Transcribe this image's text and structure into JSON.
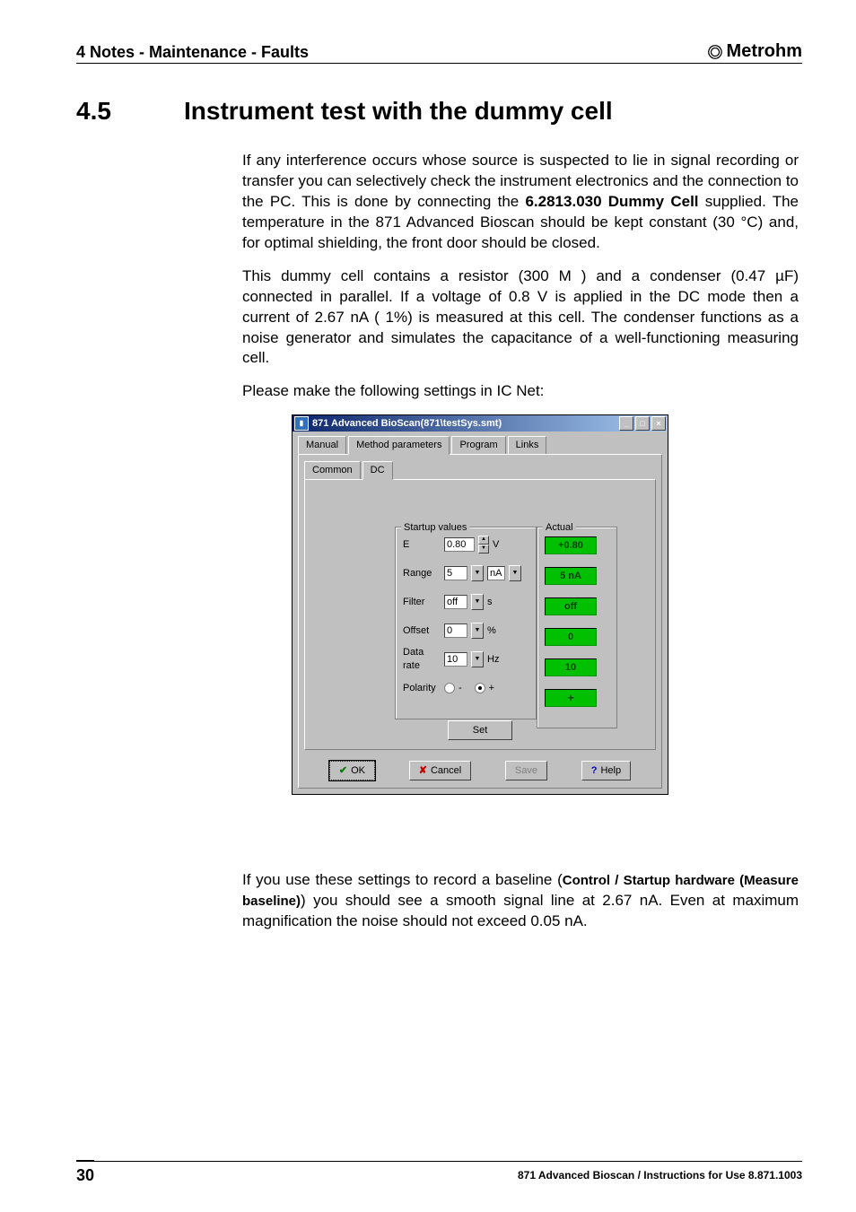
{
  "header": {
    "left": "4 Notes - Maintenance - Faults",
    "brand": "Metrohm"
  },
  "section": {
    "number": "4.5",
    "title": "Instrument test with the dummy cell"
  },
  "paras": {
    "p1a": "If any interference occurs whose source is suspected to lie in signal recording or transfer you can selectively check the instrument electronics and the connection to the PC. This is done by connecting the ",
    "p1b": "6.2813.030 Dummy Cell",
    "p1c": " supplied. The temperature in the 871 Advanced Bioscan should be kept constant (30 °C) and, for optimal shielding, the front door should be closed.",
    "p2": "This dummy cell contains a resistor (300 M ) and a condenser (0.47 µF) connected in parallel. If a voltage of 0.8 V is applied in the DC mode then a current of 2.67 nA ( 1%) is measured at this cell. The condenser functions as a noise generator and simulates the capacitance of a well-functioning measuring cell.",
    "p3": "Please make the following settings in IC Net:",
    "p4a": "If you use these settings to record a baseline (",
    "p4b": "Control / Startup hardware (Measure baseline)",
    "p4c": ") you should see a smooth signal line at 2.67 nA. Even at maximum magnification the noise should not exceed 0.05 nA."
  },
  "dialog": {
    "title": "871 Advanced BioScan(871\\testSys.smt)",
    "tabs": [
      "Manual",
      "Method parameters",
      "Program",
      "Links"
    ],
    "active_tab_index": 1,
    "subtabs": [
      "Common",
      "DC"
    ],
    "active_subtab_index": 1,
    "group_startup": "Startup values",
    "group_actual": "Actual",
    "rows": {
      "e": {
        "label": "E",
        "value": "0.80",
        "unit": "V"
      },
      "range": {
        "label": "Range",
        "value": "5",
        "unit": "nA"
      },
      "filter": {
        "label": "Filter",
        "value": "off",
        "unit": "s"
      },
      "offset": {
        "label": "Offset",
        "value": "0",
        "unit": "%"
      },
      "datarate": {
        "label": "Data rate",
        "value": "10",
        "unit": "Hz"
      },
      "polarity": {
        "label": "Polarity",
        "minus": "-",
        "plus": "+"
      }
    },
    "actual": {
      "e": "+0.80",
      "range": "5 nA",
      "filter": "off",
      "offset": "0",
      "datarate": "10",
      "polarity": "+"
    },
    "set_btn": "Set",
    "buttons": {
      "ok": "OK",
      "cancel": "Cancel",
      "save": "Save",
      "help": "Help"
    }
  },
  "footer": {
    "page": "30",
    "right": "871 Advanced Bioscan / Instructions for Use 8.871.1003"
  }
}
